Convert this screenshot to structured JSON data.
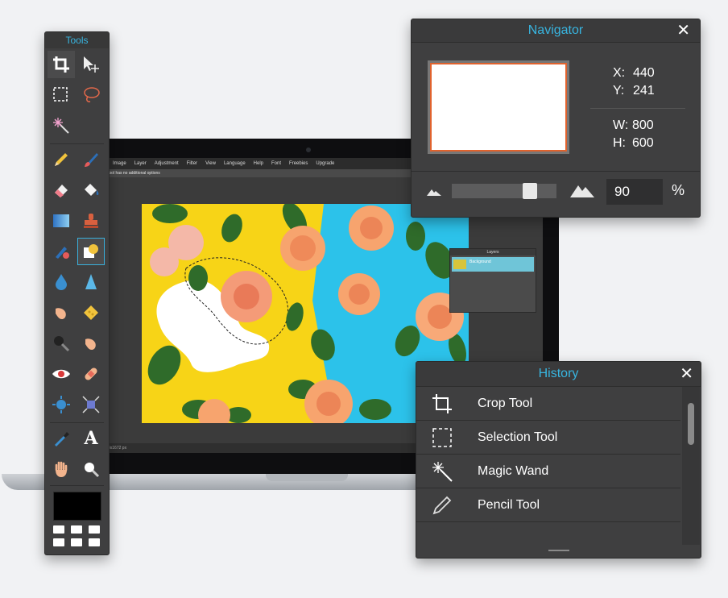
{
  "app": {
    "menu": [
      "Image",
      "Layer",
      "Adjustment",
      "Filter",
      "View",
      "Language",
      "Help",
      "Font",
      "Freebies",
      "Upgrade"
    ],
    "options_text": "tool has no additional options",
    "status_text": "8x1672 px",
    "layers_panel": {
      "title": "Layers",
      "layer_name": "Background"
    }
  },
  "tools_panel": {
    "title": "Tools",
    "tools": [
      {
        "name": "crop-tool",
        "icon": "crop-icon"
      },
      {
        "name": "move-tool",
        "icon": "move-icon"
      },
      {
        "name": "marquee-tool",
        "icon": "marquee-icon"
      },
      {
        "name": "lasso-tool",
        "icon": "lasso-icon"
      },
      {
        "name": "magic-wand-tool",
        "icon": "magic-wand-icon"
      },
      {
        "name": "pencil-tool",
        "icon": "pencil-icon"
      },
      {
        "name": "brush-tool",
        "icon": "brush-icon"
      },
      {
        "name": "eraser-tool",
        "icon": "eraser-icon"
      },
      {
        "name": "fill-tool",
        "icon": "bucket-icon"
      },
      {
        "name": "gradient-tool",
        "icon": "gradient-icon"
      },
      {
        "name": "stamp-tool",
        "icon": "stamp-icon"
      },
      {
        "name": "color-replace-tool",
        "icon": "color-replace-icon"
      },
      {
        "name": "shape-tool",
        "icon": "shape-icon"
      },
      {
        "name": "blur-tool",
        "icon": "drop-icon"
      },
      {
        "name": "sharpen-tool",
        "icon": "sharpen-icon"
      },
      {
        "name": "smudge-tool",
        "icon": "finger-icon"
      },
      {
        "name": "sponge-tool",
        "icon": "sponge-icon"
      },
      {
        "name": "dodge-tool",
        "icon": "dodge-icon"
      },
      {
        "name": "burn-tool",
        "icon": "burn-icon"
      },
      {
        "name": "red-eye-tool",
        "icon": "eye-icon"
      },
      {
        "name": "spot-heal-tool",
        "icon": "bandage-icon"
      },
      {
        "name": "bloat-tool",
        "icon": "bloat-icon"
      },
      {
        "name": "pinch-tool",
        "icon": "pinch-icon"
      },
      {
        "name": "color-picker-tool",
        "icon": "eyedropper-icon"
      },
      {
        "name": "type-tool",
        "icon": "type-icon",
        "glyph": "A"
      },
      {
        "name": "hand-tool",
        "icon": "hand-icon"
      },
      {
        "name": "zoom-tool",
        "icon": "zoom-icon"
      }
    ]
  },
  "navigator": {
    "title": "Navigator",
    "x_label": "X:",
    "x_value": "440",
    "y_label": "Y:",
    "y_value": "241",
    "w_label": "W:",
    "w_value": "800",
    "h_label": "H:",
    "h_value": "600",
    "zoom_value": "90",
    "zoom_unit": "%",
    "zoom_slider_fraction": 0.79
  },
  "history": {
    "title": "History",
    "items": [
      {
        "label": "Crop Tool",
        "icon": "crop-icon"
      },
      {
        "label": "Selection Tool",
        "icon": "selection-icon"
      },
      {
        "label": "Magic Wand",
        "icon": "magic-wand-icon"
      },
      {
        "label": "Pencil Tool",
        "icon": "pencil-icon"
      }
    ]
  },
  "colors": {
    "accent": "#38b5e0",
    "panel_bg": "#3f3f40",
    "selection_border": "#e0622d",
    "photo_yellow": "#f7d417",
    "photo_blue": "#2cc2ea"
  }
}
